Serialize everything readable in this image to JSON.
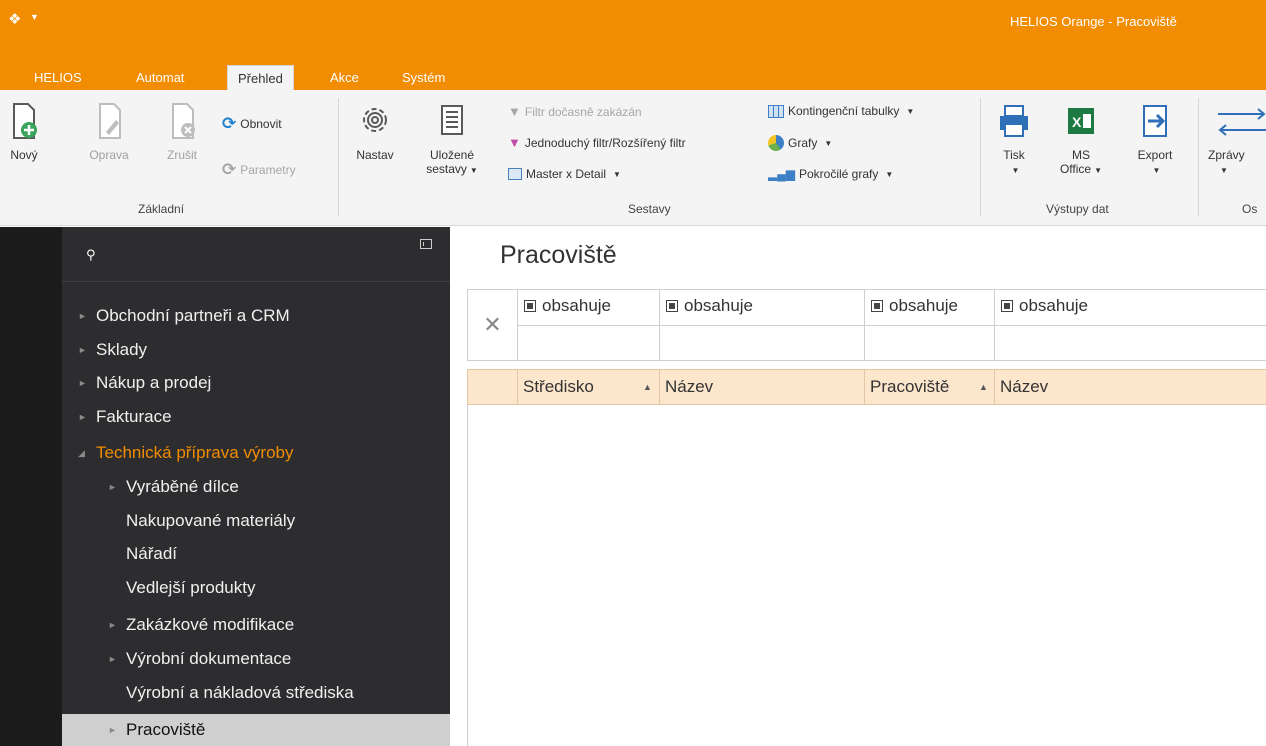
{
  "window": {
    "title": "HELIOS Orange - Pracoviště"
  },
  "ribbon_tabs": [
    "HELIOS",
    "Automat",
    "Přehled",
    "Akce",
    "Systém"
  ],
  "ribbon": {
    "zakladni": {
      "label": "Základní",
      "novy": "Nový",
      "oprava": "Oprava",
      "zrusit": "Zrušit",
      "obnovit": "Obnovit",
      "parametry": "Parametry"
    },
    "sestavy": {
      "label": "Sestavy",
      "nastav": "Nastav",
      "ulozene_1": "Uložené",
      "ulozene_2": "sestavy",
      "filtr_zakazan": "Filtr dočasně zakázán",
      "jednoduchy_filtr": "Jednoduchý filtr/Rozšířený filtr",
      "master_detail": "Master x Detail",
      "kontingencni": "Kontingenční tabulky",
      "grafy": "Grafy",
      "pokrocile_grafy": "Pokročilé grafy"
    },
    "vystupy": {
      "label": "Výstupy dat",
      "tisk": "Tisk",
      "ms_office_1": "MS",
      "ms_office_2": "Office",
      "export": "Export"
    },
    "ostatni": {
      "label_partial": "Os",
      "zpravy": "Zprávy"
    }
  },
  "nav": {
    "items": [
      "Obchodní partneři a CRM",
      "Sklady",
      "Nákup a prodej",
      "Fakturace",
      "Technická příprava výroby",
      "Vyráběné dílce",
      "Nakupované materiály",
      "Nářadí",
      "Vedlejší produkty",
      "Zakázkové modifikace",
      "Výrobní dokumentace",
      "Výrobní a nákladová střediska",
      "Pracoviště"
    ]
  },
  "main": {
    "title": "Pracoviště",
    "filter_ops": [
      "obsahuje",
      "obsahuje",
      "obsahuje",
      "obsahuje"
    ],
    "columns": [
      "Středisko",
      "Název",
      "Pracoviště",
      "Název"
    ]
  },
  "colors": {
    "accent": "#f28c00",
    "nav_bg": "#2d2d30",
    "header_bg": "#fce6cc"
  }
}
